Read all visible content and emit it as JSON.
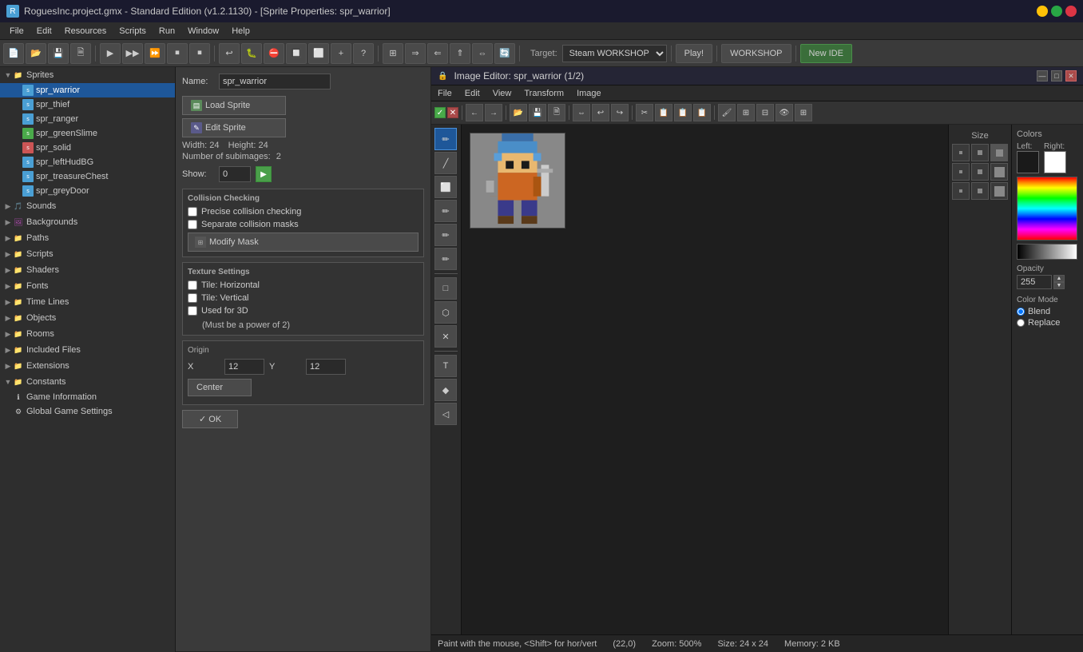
{
  "titlebar": {
    "text": "RoguesInc.project.gmx - Standard Edition (v1.2.1130) - [Sprite Properties: spr_warrior]",
    "icon": "R"
  },
  "menubar": {
    "items": [
      "File",
      "Edit",
      "Resources",
      "Scripts",
      "Run",
      "Window",
      "Help"
    ]
  },
  "toolbar": {
    "target_label": "Target:",
    "target_value": "Steam WORKSHOP",
    "play_btn": "Play!",
    "workshop_btn": "WORKSHOP",
    "new_ide_btn": "New IDE"
  },
  "sidebar": {
    "sprites_label": "Sprites",
    "sprites": [
      {
        "name": "spr_warrior",
        "selected": true
      },
      {
        "name": "spr_thief"
      },
      {
        "name": "spr_ranger"
      },
      {
        "name": "spr_greenSlime"
      },
      {
        "name": "spr_solid"
      },
      {
        "name": "spr_leftHudBG"
      },
      {
        "name": "spr_treasureChest"
      },
      {
        "name": "spr_greyDoor"
      }
    ],
    "sounds_label": "Sounds",
    "backgrounds_label": "Backgrounds",
    "paths_label": "Paths",
    "scripts_label": "Scripts",
    "shaders_label": "Shaders",
    "fonts_label": "Fonts",
    "time_lines_label": "Time Lines",
    "objects_label": "Objects",
    "rooms_label": "Rooms",
    "included_files_label": "Included Files",
    "extensions_label": "Extensions",
    "constants_label": "Constants",
    "game_info_label": "Game Information",
    "global_game_label": "Global Game Settings"
  },
  "sprite_props": {
    "name_label": "Name:",
    "name_value": "spr_warrior",
    "load_sprite_btn": "Load Sprite",
    "edit_sprite_btn": "Edit Sprite",
    "width_label": "Width:",
    "width_value": "24",
    "height_label": "Height:",
    "height_value": "24",
    "subimages_label": "Number of subimages:",
    "subimages_value": "2",
    "show_label": "Show:",
    "show_value": "0",
    "collision_checking_title": "Collision Checking",
    "precise_collision_label": "Precise collision checking",
    "separate_masks_label": "Separate collision masks",
    "modify_mask_btn": "Modify Mask",
    "texture_settings_title": "Texture Settings",
    "tile_horizontal_label": "Tile: Horizontal",
    "tile_vertical_label": "Tile: Vertical",
    "used_3d_label": "Used for 3D",
    "must_power_label": "(Must be a power of 2)",
    "origin_title": "Origin",
    "origin_x_label": "X",
    "origin_x_value": "12",
    "origin_y_label": "Y",
    "origin_y_value": "12",
    "center_btn": "Center",
    "ok_btn": "✓ OK"
  },
  "image_editor": {
    "title": "Image Editor: spr_warrior (1/2)",
    "menu_items": [
      "File",
      "Edit",
      "View",
      "Transform",
      "Image"
    ],
    "toolbar_items": [
      "✓",
      "←",
      "→",
      "📂",
      "💾",
      "🔄",
      "✂",
      "📋",
      "📋",
      "📋"
    ],
    "tools": [
      "✏",
      "✏",
      "✏",
      "✏",
      "✏",
      "✏",
      "🔲",
      "⭕",
      "✖",
      "T",
      "◆",
      "◁"
    ],
    "size_label": "Size",
    "colors_label": "Colors",
    "left_label": "Left:",
    "right_label": "Right:",
    "opacity_label": "Opacity",
    "opacity_value": "255",
    "color_mode_label": "Color Mode",
    "blend_label": "Blend",
    "replace_label": "Replace"
  },
  "status_bar": {
    "paint_text": "Paint with the mouse, <Shift> for hor/vert",
    "coords": "(22,0)",
    "zoom": "Zoom: 500%",
    "size": "Size: 24 x 24",
    "memory": "Memory: 2 KB"
  }
}
